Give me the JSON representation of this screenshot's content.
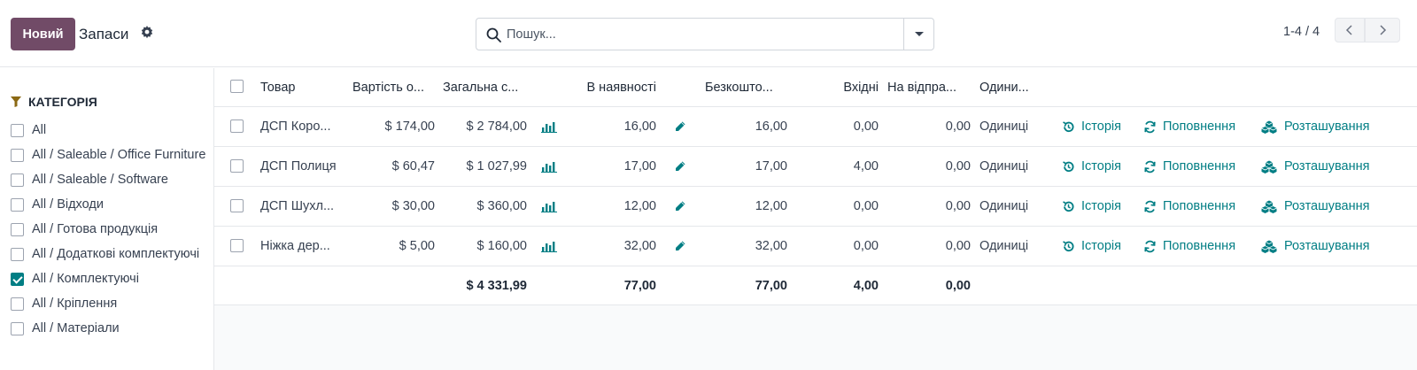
{
  "control_panel": {
    "new_button": "Новий",
    "title": "Запаси",
    "search_placeholder": "Пошук...",
    "pager": "1-4 / 4"
  },
  "sidebar": {
    "header": "КАТЕГОРІЯ",
    "categories": [
      {
        "label": "All",
        "checked": false
      },
      {
        "label": "All / Saleable / Office Furniture",
        "checked": false
      },
      {
        "label": "All / Saleable / Software",
        "checked": false
      },
      {
        "label": "All / Відходи",
        "checked": false
      },
      {
        "label": "All / Готова продукція",
        "checked": false
      },
      {
        "label": "All / Додаткові комплектуючі",
        "checked": false
      },
      {
        "label": "All / Комплектуючі",
        "checked": true
      },
      {
        "label": "All / Кріплення",
        "checked": false
      },
      {
        "label": "All / Матеріали",
        "checked": false
      }
    ]
  },
  "table": {
    "columns": {
      "product": "Товар",
      "unit_value": "Вартість о...",
      "total_value": "Загальна с...",
      "on_hand": "В наявності",
      "free": "Безкошто...",
      "incoming": "Вхідні",
      "outgoing": "На відпра...",
      "uom": "Одини..."
    },
    "rows": [
      {
        "product": "ДСП Коро...",
        "unit_value": "$ 174,00",
        "total_value": "$ 2 784,00",
        "on_hand": "16,00",
        "free": "16,00",
        "incoming": "0,00",
        "outgoing": "0,00",
        "uom": "Одиниці"
      },
      {
        "product": "ДСП Полиця",
        "unit_value": "$ 60,47",
        "total_value": "$ 1 027,99",
        "on_hand": "17,00",
        "free": "17,00",
        "incoming": "4,00",
        "outgoing": "0,00",
        "uom": "Одиниці"
      },
      {
        "product": "ДСП Шухл...",
        "unit_value": "$ 30,00",
        "total_value": "$ 360,00",
        "on_hand": "12,00",
        "free": "12,00",
        "incoming": "0,00",
        "outgoing": "0,00",
        "uom": "Одиниці"
      },
      {
        "product": "Ніжка дер...",
        "unit_value": "$ 5,00",
        "total_value": "$ 160,00",
        "on_hand": "32,00",
        "free": "32,00",
        "incoming": "0,00",
        "outgoing": "0,00",
        "uom": "Одиниці"
      }
    ],
    "actions": {
      "history": "Історія",
      "replenish": "Поповнення",
      "locations": "Розташування"
    },
    "totals": {
      "total_value": "$ 4 331,99",
      "on_hand": "77,00",
      "free": "77,00",
      "incoming": "4,00",
      "outgoing": "0,00"
    }
  },
  "colors": {
    "brand": "#714b67",
    "accent": "#017e84"
  }
}
